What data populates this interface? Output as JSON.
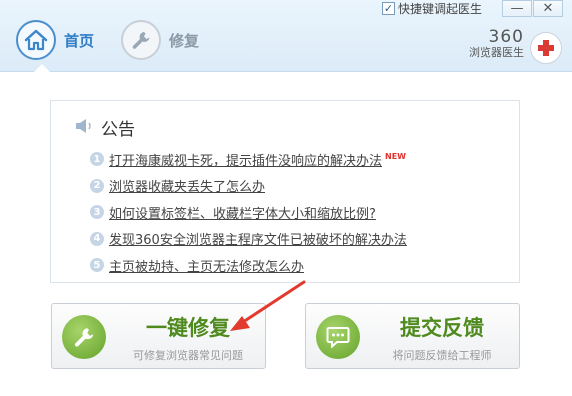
{
  "header": {
    "shortcut_label": "快捷键调起医生",
    "shortcut_checked": true,
    "minimize_glyph": "—",
    "close_glyph": "✕",
    "nav": [
      {
        "label": "首页",
        "icon": "home-icon",
        "active": true
      },
      {
        "label": "修复",
        "icon": "wrench-icon",
        "active": false
      }
    ],
    "brand_number": "360",
    "brand_name": "浏览器医生"
  },
  "notice": {
    "title": "公告",
    "items": [
      {
        "num": "1",
        "text": "打开海康威视卡死，提示插件没响应的解决办法",
        "badge": "NEW"
      },
      {
        "num": "2",
        "text": "浏览器收藏夹丢失了怎么办"
      },
      {
        "num": "3",
        "text": "如何设置标签栏、收藏栏字体大小和缩放比例?"
      },
      {
        "num": "4",
        "text": "发现360安全浏览器主程序文件已被破坏的解决办法"
      },
      {
        "num": "5",
        "text": "主页被劫持、主页无法修改怎么办"
      }
    ]
  },
  "actions": {
    "repair": {
      "title": "一键修复",
      "subtitle": "可修复浏览器常见问题"
    },
    "feedback": {
      "title": "提交反馈",
      "subtitle": "将问题反馈给工程师"
    }
  },
  "colors": {
    "accent_blue": "#2f7ec6",
    "action_green": "#4e8a1e",
    "annotation_red": "#e23a2c"
  }
}
